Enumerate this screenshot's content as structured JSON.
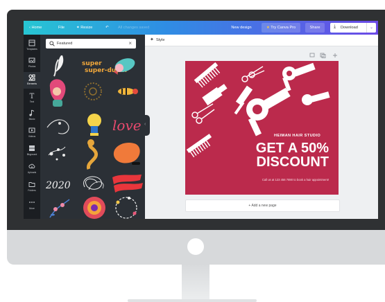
{
  "topbar": {
    "home": "Home",
    "file": "File",
    "resize": "Resize",
    "saved_status": "All changes saved",
    "new_design": "New design",
    "try_pro": "Try Canva Pro",
    "share": "Share",
    "download": "Download"
  },
  "rail": {
    "items": [
      {
        "label": "Templates",
        "icon": "template-icon"
      },
      {
        "label": "Photos",
        "icon": "photo-icon"
      },
      {
        "label": "Elements",
        "icon": "shapes-icon"
      },
      {
        "label": "Text",
        "icon": "text-icon"
      },
      {
        "label": "Music",
        "icon": "music-note-icon"
      },
      {
        "label": "Videos",
        "icon": "video-icon"
      },
      {
        "label": "Bkground",
        "icon": "background-icon"
      },
      {
        "label": "Uploads",
        "icon": "upload-icon"
      },
      {
        "label": "Folders",
        "icon": "folder-icon"
      },
      {
        "label": "More",
        "icon": "more-icon"
      }
    ]
  },
  "panel": {
    "search_value": "Featured",
    "elements": [
      {
        "name": "brush-stroke-element"
      },
      {
        "name": "super-duper-sticker",
        "text": "super-duper"
      },
      {
        "name": "bird-element"
      },
      {
        "name": "woman-portrait-element"
      },
      {
        "name": "sunburst-element"
      },
      {
        "name": "bee-element"
      },
      {
        "name": "abstract-line-face-element"
      },
      {
        "name": "lightbulb-element"
      },
      {
        "name": "love-lettering-sticker",
        "text": "love"
      },
      {
        "name": "floral-doodle-element"
      },
      {
        "name": "cobra-element"
      },
      {
        "name": "orange-blob-element"
      },
      {
        "name": "2020-lettering-sticker",
        "text": "2020"
      },
      {
        "name": "scribble-element"
      },
      {
        "name": "red-brush-stroke-element"
      },
      {
        "name": "floral-branch-element"
      },
      {
        "name": "mandala-element"
      },
      {
        "name": "flower-wreath-element"
      }
    ]
  },
  "canvas": {
    "style_label": "Style",
    "add_page": "+ Add a new page",
    "poster": {
      "studio": "HEIMAN HAIR STUDIO",
      "headline_1": "GET A 50%",
      "headline_2": "DISCOUNT",
      "contact": "Call us at 123 456 7890 to book a hair appointment!"
    }
  },
  "colors": {
    "poster_bg": "#bb2a4c",
    "topbar_start": "#27c6d3",
    "topbar_end": "#6c4ae6",
    "panel_bg": "#2b3036"
  }
}
